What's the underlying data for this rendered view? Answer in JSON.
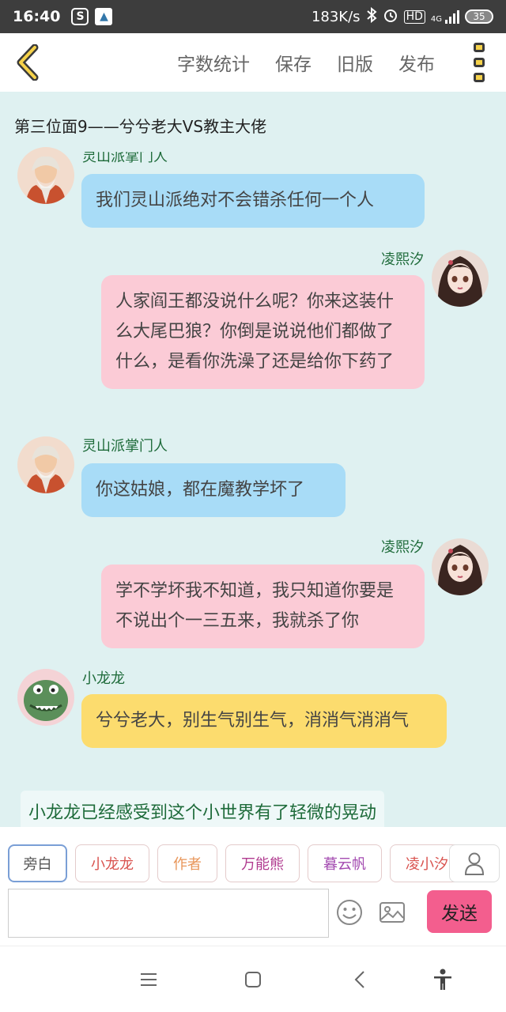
{
  "status_bar": {
    "time": "16:40",
    "network_speed": "183K/s",
    "signal_label": "4G",
    "hd_label": "HD",
    "battery": "35"
  },
  "header": {
    "actions": [
      "字数统计",
      "保存",
      "旧版",
      "发布"
    ]
  },
  "chat": {
    "title": "第三位面9——兮兮老大VS教主大佬",
    "messages": [
      {
        "sender": "灵山派掌门人",
        "side": "left",
        "color": "blue",
        "text": "我们灵山派绝对不会错杀任何一个人"
      },
      {
        "sender": "凌熙汐",
        "side": "right",
        "color": "pink",
        "text": "人家阎王都没说什么呢？你来这装什么大尾巴狼？你倒是说说他们都做了什么，是看你洗澡了还是给你下药了"
      },
      {
        "sender": "灵山派掌门人",
        "side": "left",
        "color": "blue",
        "text": "你这姑娘，都在魔教学坏了"
      },
      {
        "sender": "凌熙汐",
        "side": "right",
        "color": "pink",
        "text": "学不学坏我不知道，我只知道你要是不说出个一三五来，我就杀了你"
      },
      {
        "sender": "小龙龙",
        "side": "left",
        "color": "yellow",
        "text": "兮兮老大，别生气别生气，消消气消消气"
      }
    ],
    "narration": "小龙龙已经感受到这个小世界有了轻微的晃动"
  },
  "roles": [
    {
      "label": "旁白",
      "color": "#555555",
      "active": true
    },
    {
      "label": "小龙龙",
      "color": "#d9534f",
      "active": false
    },
    {
      "label": "作者",
      "color": "#e8965a",
      "active": false
    },
    {
      "label": "万能熊",
      "color": "#b03a8f",
      "active": false
    },
    {
      "label": "暮云帆",
      "color": "#a34ab0",
      "active": false
    },
    {
      "label": "凌小汐",
      "color": "#d9534f",
      "active": false
    }
  ],
  "input": {
    "placeholder": "",
    "send_label": "发送"
  },
  "colors": {
    "chat_bg": "#dff1f1",
    "bubble_blue": "#a8dcf7",
    "bubble_pink": "#fbcbd6",
    "bubble_yellow": "#fcdc6e",
    "send_button": "#f35e8e",
    "name_green": "#1e6b3a"
  },
  "icons": {
    "back": "chevron-left-icon",
    "more": "more-vertical-icon",
    "emoji": "smiley-icon",
    "image": "image-icon",
    "person": "person-icon",
    "nav_menu": "menu-icon",
    "nav_home": "square-icon",
    "nav_back": "back-icon",
    "nav_accessibility": "accessibility-icon"
  }
}
